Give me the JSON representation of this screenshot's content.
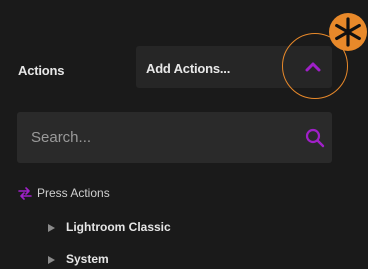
{
  "header": {
    "actions_label": "Actions",
    "dropdown_value": "Add Actions..."
  },
  "search": {
    "placeholder": "Search..."
  },
  "tree": {
    "group_label": "Press Actions",
    "items": [
      {
        "label": "Lightroom Classic"
      },
      {
        "label": "System"
      }
    ]
  },
  "colors": {
    "accent": "#a020c8",
    "highlight": "#e8892a",
    "background": "#1a1a1a"
  },
  "icons": {
    "chevron": "chevron-up-icon",
    "search": "search-icon",
    "press": "press-actions-icon",
    "marker": "asterisk-icon"
  }
}
